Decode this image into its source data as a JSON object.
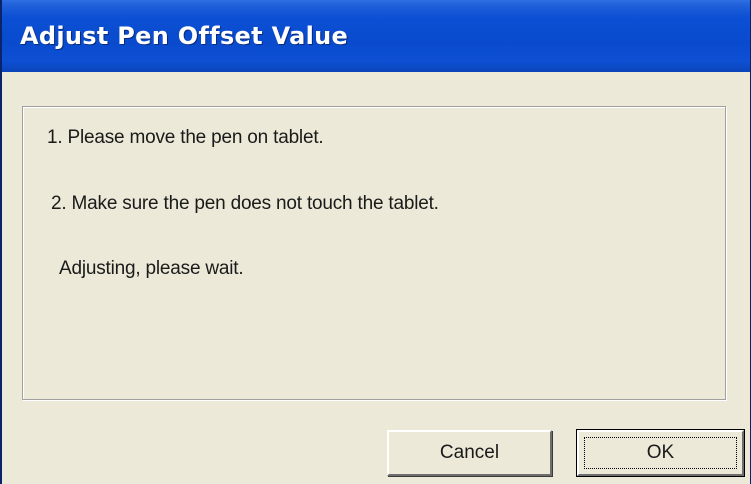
{
  "window": {
    "title": "Adjust Pen Offset Value"
  },
  "content": {
    "line1": "1. Please move the pen on tablet.",
    "line2": "2. Make sure the pen does not touch the tablet.",
    "status": "Adjusting, please wait."
  },
  "buttons": {
    "cancel_label": "Cancel",
    "ok_label": "OK"
  },
  "colors": {
    "titlebar": "#0a4bce",
    "dialog_background": "#ece9d8",
    "title_text": "#ffffff"
  }
}
